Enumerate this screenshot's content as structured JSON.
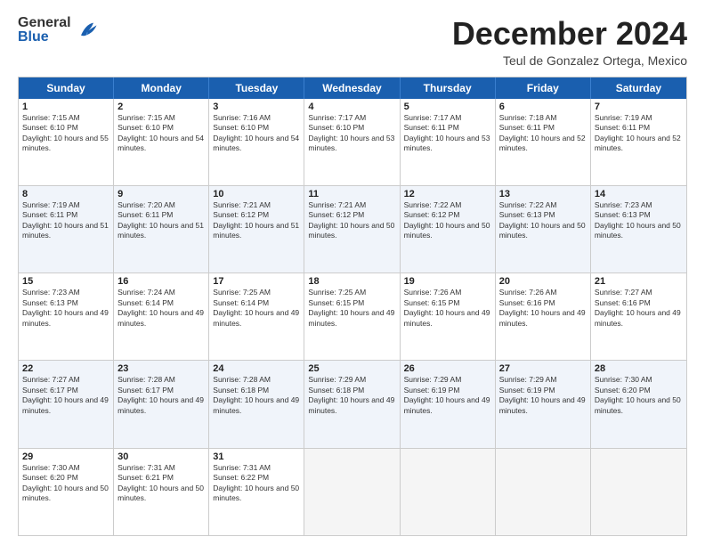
{
  "header": {
    "logo_general": "General",
    "logo_blue": "Blue",
    "month_title": "December 2024",
    "location": "Teul de Gonzalez Ortega, Mexico"
  },
  "days_of_week": [
    "Sunday",
    "Monday",
    "Tuesday",
    "Wednesday",
    "Thursday",
    "Friday",
    "Saturday"
  ],
  "rows": [
    {
      "alt": false,
      "cells": [
        {
          "day": "1",
          "sunrise": "Sunrise: 7:15 AM",
          "sunset": "Sunset: 6:10 PM",
          "daylight": "Daylight: 10 hours and 55 minutes."
        },
        {
          "day": "2",
          "sunrise": "Sunrise: 7:15 AM",
          "sunset": "Sunset: 6:10 PM",
          "daylight": "Daylight: 10 hours and 54 minutes."
        },
        {
          "day": "3",
          "sunrise": "Sunrise: 7:16 AM",
          "sunset": "Sunset: 6:10 PM",
          "daylight": "Daylight: 10 hours and 54 minutes."
        },
        {
          "day": "4",
          "sunrise": "Sunrise: 7:17 AM",
          "sunset": "Sunset: 6:10 PM",
          "daylight": "Daylight: 10 hours and 53 minutes."
        },
        {
          "day": "5",
          "sunrise": "Sunrise: 7:17 AM",
          "sunset": "Sunset: 6:11 PM",
          "daylight": "Daylight: 10 hours and 53 minutes."
        },
        {
          "day": "6",
          "sunrise": "Sunrise: 7:18 AM",
          "sunset": "Sunset: 6:11 PM",
          "daylight": "Daylight: 10 hours and 52 minutes."
        },
        {
          "day": "7",
          "sunrise": "Sunrise: 7:19 AM",
          "sunset": "Sunset: 6:11 PM",
          "daylight": "Daylight: 10 hours and 52 minutes."
        }
      ]
    },
    {
      "alt": true,
      "cells": [
        {
          "day": "8",
          "sunrise": "Sunrise: 7:19 AM",
          "sunset": "Sunset: 6:11 PM",
          "daylight": "Daylight: 10 hours and 51 minutes."
        },
        {
          "day": "9",
          "sunrise": "Sunrise: 7:20 AM",
          "sunset": "Sunset: 6:11 PM",
          "daylight": "Daylight: 10 hours and 51 minutes."
        },
        {
          "day": "10",
          "sunrise": "Sunrise: 7:21 AM",
          "sunset": "Sunset: 6:12 PM",
          "daylight": "Daylight: 10 hours and 51 minutes."
        },
        {
          "day": "11",
          "sunrise": "Sunrise: 7:21 AM",
          "sunset": "Sunset: 6:12 PM",
          "daylight": "Daylight: 10 hours and 50 minutes."
        },
        {
          "day": "12",
          "sunrise": "Sunrise: 7:22 AM",
          "sunset": "Sunset: 6:12 PM",
          "daylight": "Daylight: 10 hours and 50 minutes."
        },
        {
          "day": "13",
          "sunrise": "Sunrise: 7:22 AM",
          "sunset": "Sunset: 6:13 PM",
          "daylight": "Daylight: 10 hours and 50 minutes."
        },
        {
          "day": "14",
          "sunrise": "Sunrise: 7:23 AM",
          "sunset": "Sunset: 6:13 PM",
          "daylight": "Daylight: 10 hours and 50 minutes."
        }
      ]
    },
    {
      "alt": false,
      "cells": [
        {
          "day": "15",
          "sunrise": "Sunrise: 7:23 AM",
          "sunset": "Sunset: 6:13 PM",
          "daylight": "Daylight: 10 hours and 49 minutes."
        },
        {
          "day": "16",
          "sunrise": "Sunrise: 7:24 AM",
          "sunset": "Sunset: 6:14 PM",
          "daylight": "Daylight: 10 hours and 49 minutes."
        },
        {
          "day": "17",
          "sunrise": "Sunrise: 7:25 AM",
          "sunset": "Sunset: 6:14 PM",
          "daylight": "Daylight: 10 hours and 49 minutes."
        },
        {
          "day": "18",
          "sunrise": "Sunrise: 7:25 AM",
          "sunset": "Sunset: 6:15 PM",
          "daylight": "Daylight: 10 hours and 49 minutes."
        },
        {
          "day": "19",
          "sunrise": "Sunrise: 7:26 AM",
          "sunset": "Sunset: 6:15 PM",
          "daylight": "Daylight: 10 hours and 49 minutes."
        },
        {
          "day": "20",
          "sunrise": "Sunrise: 7:26 AM",
          "sunset": "Sunset: 6:16 PM",
          "daylight": "Daylight: 10 hours and 49 minutes."
        },
        {
          "day": "21",
          "sunrise": "Sunrise: 7:27 AM",
          "sunset": "Sunset: 6:16 PM",
          "daylight": "Daylight: 10 hours and 49 minutes."
        }
      ]
    },
    {
      "alt": true,
      "cells": [
        {
          "day": "22",
          "sunrise": "Sunrise: 7:27 AM",
          "sunset": "Sunset: 6:17 PM",
          "daylight": "Daylight: 10 hours and 49 minutes."
        },
        {
          "day": "23",
          "sunrise": "Sunrise: 7:28 AM",
          "sunset": "Sunset: 6:17 PM",
          "daylight": "Daylight: 10 hours and 49 minutes."
        },
        {
          "day": "24",
          "sunrise": "Sunrise: 7:28 AM",
          "sunset": "Sunset: 6:18 PM",
          "daylight": "Daylight: 10 hours and 49 minutes."
        },
        {
          "day": "25",
          "sunrise": "Sunrise: 7:29 AM",
          "sunset": "Sunset: 6:18 PM",
          "daylight": "Daylight: 10 hours and 49 minutes."
        },
        {
          "day": "26",
          "sunrise": "Sunrise: 7:29 AM",
          "sunset": "Sunset: 6:19 PM",
          "daylight": "Daylight: 10 hours and 49 minutes."
        },
        {
          "day": "27",
          "sunrise": "Sunrise: 7:29 AM",
          "sunset": "Sunset: 6:19 PM",
          "daylight": "Daylight: 10 hours and 49 minutes."
        },
        {
          "day": "28",
          "sunrise": "Sunrise: 7:30 AM",
          "sunset": "Sunset: 6:20 PM",
          "daylight": "Daylight: 10 hours and 50 minutes."
        }
      ]
    },
    {
      "alt": false,
      "cells": [
        {
          "day": "29",
          "sunrise": "Sunrise: 7:30 AM",
          "sunset": "Sunset: 6:20 PM",
          "daylight": "Daylight: 10 hours and 50 minutes."
        },
        {
          "day": "30",
          "sunrise": "Sunrise: 7:31 AM",
          "sunset": "Sunset: 6:21 PM",
          "daylight": "Daylight: 10 hours and 50 minutes."
        },
        {
          "day": "31",
          "sunrise": "Sunrise: 7:31 AM",
          "sunset": "Sunset: 6:22 PM",
          "daylight": "Daylight: 10 hours and 50 minutes."
        },
        {
          "day": "",
          "sunrise": "",
          "sunset": "",
          "daylight": ""
        },
        {
          "day": "",
          "sunrise": "",
          "sunset": "",
          "daylight": ""
        },
        {
          "day": "",
          "sunrise": "",
          "sunset": "",
          "daylight": ""
        },
        {
          "day": "",
          "sunrise": "",
          "sunset": "",
          "daylight": ""
        }
      ]
    }
  ]
}
